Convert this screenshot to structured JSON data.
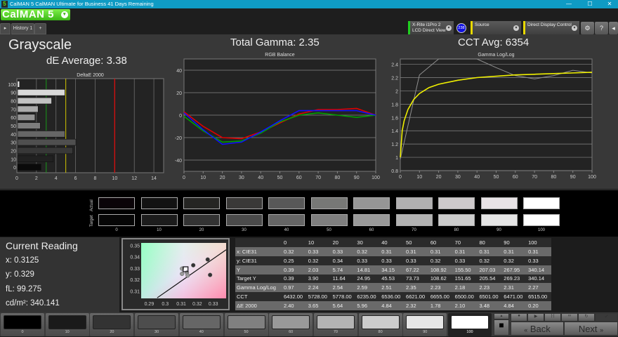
{
  "window": {
    "title": "CalMAN 5 CalMAN Ultimate for Business 41 Days Remaining",
    "app_icon": "5",
    "minimize": "—",
    "maximize": "☐",
    "close": "✕"
  },
  "logo": {
    "text": "CalMAN 5"
  },
  "tabs": [
    {
      "label": "History 1"
    }
  ],
  "toolbar": {
    "meter_line1": "X-Rite i1Pro 2",
    "meter_line2": "LCD Direct View",
    "meter_badge": "238",
    "source": "Source",
    "display": "Direct Display Control"
  },
  "header": {
    "title": "Grayscale",
    "de_average": "dE Average: 3.38",
    "total_gamma": "Total Gamma: 2.35",
    "cct_avg": "CCT Avg: 6354"
  },
  "colors": {
    "red": "#e00000",
    "green": "#00a000",
    "blue": "#1010ff",
    "target_gamma": "#f0f000",
    "measured_gamma": "#909090",
    "de_green": "#1a9a1a",
    "de_yellow": "#d4c800",
    "de_red": "#d01010"
  },
  "chart_data": [
    {
      "type": "bar",
      "title": "DeltaE 2000",
      "orientation": "horizontal",
      "categories": [
        "0",
        "10",
        "20",
        "30",
        "40",
        "50",
        "60",
        "70",
        "80",
        "90",
        "100"
      ],
      "values": [
        2.4,
        3.65,
        5.64,
        5.96,
        4.84,
        2.32,
        1.78,
        2.1,
        3.48,
        4.84,
        0.2
      ],
      "xlim": [
        0,
        15
      ],
      "xticks": [
        0,
        2,
        4,
        6,
        8,
        10,
        12,
        14
      ],
      "threshold_lines": [
        3,
        5,
        10
      ],
      "grid": true
    },
    {
      "type": "line",
      "title": "RGB Balance",
      "x": [
        0,
        10,
        20,
        30,
        40,
        50,
        60,
        70,
        80,
        90,
        100
      ],
      "series": [
        {
          "color": "red",
          "values": [
            3,
            -10,
            -20,
            -21,
            -15,
            -7,
            1,
            5,
            5,
            6,
            0
          ]
        },
        {
          "color": "green",
          "values": [
            -1,
            -14,
            -24,
            -23,
            -16,
            -6,
            0,
            2,
            0,
            -2,
            0
          ]
        },
        {
          "color": "blue",
          "values": [
            2,
            -13,
            -26,
            -24,
            -15,
            -5,
            4,
            4,
            4,
            4,
            0
          ]
        }
      ],
      "ylim": [
        -50,
        50
      ],
      "yticks": [
        -40,
        -20,
        0,
        20,
        40
      ],
      "xticks": [
        0,
        10,
        20,
        30,
        40,
        50,
        60,
        70,
        80,
        90,
        100
      ],
      "grid": true
    },
    {
      "type": "line",
      "title": "Gamma Log/Log",
      "series": [
        {
          "color": "measured",
          "x": [
            0,
            10,
            20,
            30,
            40,
            50,
            60,
            70,
            80,
            90,
            100
          ],
          "values": [
            0.97,
            2.24,
            2.54,
            2.59,
            2.51,
            2.35,
            2.23,
            2.18,
            2.23,
            2.31,
            2.27
          ]
        },
        {
          "color": "target",
          "x": [
            0,
            1,
            2,
            4,
            7,
            10,
            15,
            20,
            30,
            40,
            50,
            60,
            70,
            80,
            90,
            100
          ],
          "values": [
            1.0,
            1.4,
            1.55,
            1.72,
            1.87,
            1.96,
            2.05,
            2.1,
            2.16,
            2.2,
            2.22,
            2.24,
            2.25,
            2.26,
            2.27,
            2.28
          ]
        }
      ],
      "ylim": [
        0.8,
        2.48
      ],
      "yticks": [
        0.8,
        1,
        1.2,
        1.4,
        1.6,
        1.8,
        2,
        2.2,
        2.4
      ],
      "xticks": [
        0,
        10,
        20,
        30,
        40,
        50,
        60,
        70,
        80,
        90,
        100
      ],
      "grid": true
    },
    {
      "type": "scatter",
      "title": "",
      "xlim": [
        0.285,
        0.338
      ],
      "ylim": [
        0.3035,
        0.352
      ],
      "xticks": [
        0.29,
        0.3,
        0.31,
        0.32,
        0.33
      ],
      "yticks": [
        0.31,
        0.32,
        0.33,
        0.34,
        0.35
      ],
      "points": [
        [
          0.3175,
          0.3325
        ],
        [
          0.3265,
          0.3375
        ],
        [
          0.328,
          0.324
        ],
        [
          0.3105,
          0.3295
        ],
        [
          0.3105,
          0.325
        ],
        [
          0.3135,
          0.326
        ],
        [
          0.314,
          0.3235
        ]
      ],
      "current": [
        0.3125,
        0.329
      ],
      "target": [
        0.3127,
        0.329
      ],
      "locus": [
        [
          0.295,
          0.304
        ],
        [
          0.338,
          0.346
        ]
      ]
    }
  ],
  "swatches": {
    "labels": [
      "0",
      "10",
      "20",
      "30",
      "40",
      "50",
      "60",
      "70",
      "80",
      "90",
      "100"
    ],
    "actual": [
      "#0a0408",
      "#131313",
      "#252523",
      "#3a3938",
      "#585858",
      "#777876",
      "#969696",
      "#b1b0b1",
      "#cdc9cb",
      "#e8e3e6",
      "#ffffff"
    ],
    "target": [
      "#060606",
      "#1c1c1c",
      "#333333",
      "#4b4b4b",
      "#656565",
      "#7f7f7f",
      "#999999",
      "#b2b2b2",
      "#cccccc",
      "#e5e5e5",
      "#ffffff"
    ],
    "actual_label": "Actual",
    "target_label": "Target"
  },
  "reading": {
    "title": "Current Reading",
    "x": "x: 0.3125",
    "y": "y: 0.329",
    "fl": "fL: 99.275",
    "cdm2": "cd/m²: 340.141"
  },
  "table": {
    "headers": [
      "",
      "0",
      "10",
      "20",
      "30",
      "40",
      "50",
      "60",
      "70",
      "80",
      "90",
      "100"
    ],
    "rows": [
      [
        "x: CIE31",
        "0.32",
        "0.33",
        "0.33",
        "0.32",
        "0.31",
        "0.31",
        "0.31",
        "0.31",
        "0.31",
        "0.31",
        "0.31"
      ],
      [
        "y: CIE31",
        "0.25",
        "0.32",
        "0.34",
        "0.33",
        "0.33",
        "0.33",
        "0.32",
        "0.33",
        "0.32",
        "0.32",
        "0.33"
      ],
      [
        "Y",
        "0.39",
        "2.03",
        "5.74",
        "14.81",
        "34.15",
        "67.22",
        "108.92",
        "155.50",
        "207.03",
        "267.95",
        "340.14"
      ],
      [
        "Target Y",
        "0.39",
        "3.90",
        "11.64",
        "24.95",
        "45.53",
        "73.73",
        "108.62",
        "151.65",
        "205.54",
        "269.23",
        "340.14"
      ],
      [
        "Gamma Log/Log",
        "0.97",
        "2.24",
        "2.54",
        "2.59",
        "2.51",
        "2.35",
        "2.23",
        "2.18",
        "2.23",
        "2.31",
        "2.27"
      ],
      [
        "CCT",
        "6432.00",
        "5728.00",
        "5778.00",
        "6235.00",
        "6536.00",
        "6621.00",
        "6655.00",
        "6500.00",
        "6501.00",
        "6471.00",
        "6515.00"
      ],
      [
        "ΔE 2000",
        "2.40",
        "3.65",
        "5.64",
        "5.96",
        "4.84",
        "2.32",
        "1.78",
        "2.10",
        "3.48",
        "4.84",
        "0.20"
      ]
    ]
  },
  "bottom": {
    "swatch_labels": [
      "0",
      "10",
      "20",
      "30",
      "40",
      "50",
      "60",
      "70",
      "80",
      "90",
      "100"
    ],
    "swatch_colors": [
      "#000000",
      "#1a1a1a",
      "#333333",
      "#4d4d4d",
      "#666666",
      "#808080",
      "#999999",
      "#b3b3b3",
      "#cccccc",
      "#e6e6e6",
      "#ffffff"
    ],
    "back": "Back",
    "next": "Next",
    "back_icon": "«",
    "next_icon": "»"
  }
}
